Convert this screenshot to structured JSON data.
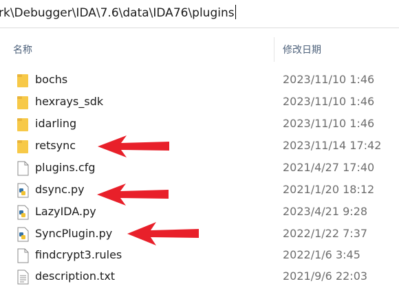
{
  "address": {
    "path": "rk\\Debugger\\IDA\\7.6\\data\\IDA76\\plugins"
  },
  "columns": {
    "name": "名称",
    "date": "修改日期"
  },
  "files": [
    {
      "name": "bochs",
      "date": "2023/11/10 1:46",
      "icon": "folder-icon"
    },
    {
      "name": "hexrays_sdk",
      "date": "2023/11/10 1:46",
      "icon": "folder-icon"
    },
    {
      "name": "idarling",
      "date": "2023/11/10 1:46",
      "icon": "folder-icon"
    },
    {
      "name": "retsync",
      "date": "2023/11/14 17:42",
      "icon": "folder-icon"
    },
    {
      "name": "plugins.cfg",
      "date": "2021/4/27 17:40",
      "icon": "file-icon"
    },
    {
      "name": "dsync.py",
      "date": "2021/1/20 18:12",
      "icon": "python-file-icon"
    },
    {
      "name": "LazyIDA.py",
      "date": "2023/4/21 9:28",
      "icon": "python-file-icon"
    },
    {
      "name": "SyncPlugin.py",
      "date": "2022/1/22 7:37",
      "icon": "python-file-icon"
    },
    {
      "name": "findcrypt3.rules",
      "date": "2022/1/6 3:45",
      "icon": "file-icon"
    },
    {
      "name": "description.txt",
      "date": "2021/9/6 22:03",
      "icon": "text-file-icon"
    }
  ],
  "colors": {
    "folder": "#f7c948",
    "arrow": "#e8202a",
    "header_text": "#4c607a",
    "date_text": "#6d6d6d"
  }
}
